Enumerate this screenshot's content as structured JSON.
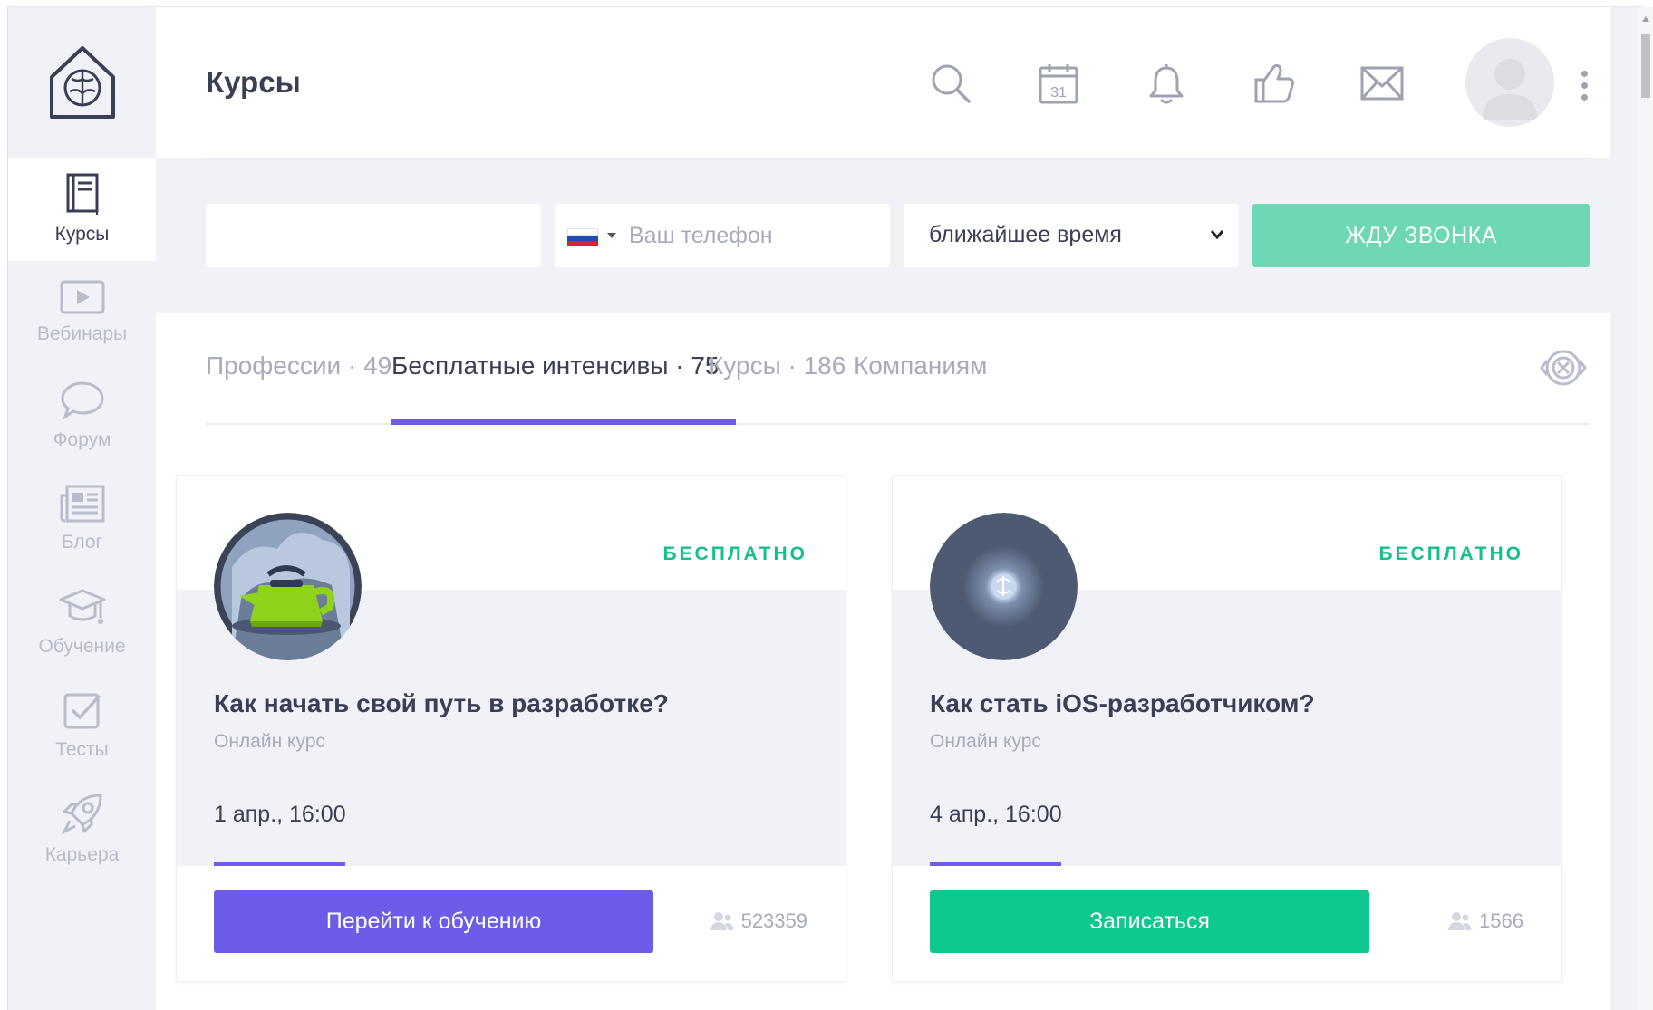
{
  "app": {
    "title": "Курсы"
  },
  "sidebar": {
    "items": [
      {
        "label": "Курсы",
        "icon": "book-icon",
        "active": true
      },
      {
        "label": "Вебинары",
        "icon": "play-icon",
        "active": false
      },
      {
        "label": "Форум",
        "icon": "chat-bubble-icon",
        "active": false
      },
      {
        "label": "Блог",
        "icon": "newspaper-icon",
        "active": false
      },
      {
        "label": "Обучение",
        "icon": "graduation-cap-icon",
        "active": false
      },
      {
        "label": "Тесты",
        "icon": "checkbox-icon",
        "active": false
      },
      {
        "label": "Карьера",
        "icon": "rocket-icon",
        "active": false
      }
    ]
  },
  "header": {
    "icons": [
      "search-icon",
      "calendar-icon",
      "bell-icon",
      "thumbs-up-icon",
      "mail-icon"
    ],
    "calendar_day": "31"
  },
  "callback_form": {
    "name_value": "",
    "phone_placeholder": "Ваш телефон",
    "time_selected": "ближайшее время",
    "submit_label": "ЖДУ ЗВОНКА"
  },
  "tabs": [
    {
      "label": "Профессии",
      "count": "49",
      "active": false
    },
    {
      "label": "Бесплатные интенсивы",
      "count": "75",
      "active": true
    },
    {
      "label": "Курсы",
      "count": "186",
      "active": false
    },
    {
      "label": "Компаниям",
      "count": "",
      "active": false
    }
  ],
  "cards": [
    {
      "badge": "БЕСПЛАТНО",
      "title": "Как начать свой путь в разработке?",
      "type": "Онлайн курс",
      "date": "1 апр., 16:00",
      "button": "Перейти к обучению",
      "count": "523359"
    },
    {
      "badge": "БЕСПЛАТНО",
      "title": "Как стать iOS-разработчиком?",
      "type": "Онлайн курс",
      "date": "4 апр., 16:00",
      "button": "Записаться",
      "count": "1566"
    }
  ],
  "colors": {
    "accent": "#6c5ce7",
    "green": "#0ec98f",
    "callback": "#6ed8b5",
    "badge": "#16c08c"
  }
}
